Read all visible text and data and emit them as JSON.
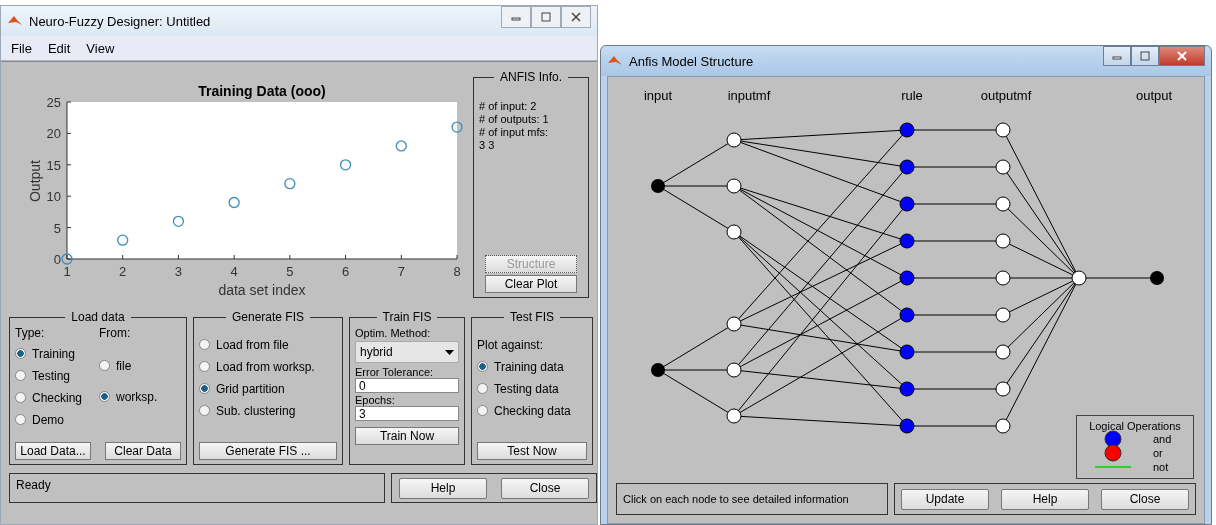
{
  "left_window": {
    "title": "Neuro-Fuzzy Designer: Untitled",
    "menu": [
      "File",
      "Edit",
      "View"
    ],
    "plot": {
      "chart_data": {
        "type": "scatter",
        "title": "Training Data (ooo)",
        "xlabel": "data set index",
        "ylabel": "Output",
        "x": [
          1,
          2,
          3,
          4,
          5,
          6,
          7,
          8
        ],
        "series": [
          {
            "color": "#3a8fb7",
            "values": [
              0,
              3,
              6,
              9,
              12,
              15,
              18,
              21
            ]
          }
        ],
        "xlim": [
          1,
          8
        ],
        "ylim": [
          0,
          25
        ],
        "xticks": [
          1,
          2,
          3,
          4,
          5,
          6,
          7,
          8
        ],
        "yticks": [
          0,
          5,
          10,
          15,
          20,
          25
        ]
      }
    },
    "anfis_info": {
      "title": "ANFIS Info.",
      "lines": [
        "# of input: 2",
        "# of outputs: 1",
        "# of input mfs:",
        "3  3"
      ],
      "buttons": [
        {
          "label": "Structure",
          "disabled": true
        },
        {
          "label": "Clear Plot",
          "disabled": false
        }
      ]
    },
    "load_data": {
      "title": "Load data",
      "type_label": "Type:",
      "from_label": "From:",
      "types": [
        {
          "label": "Training",
          "selected": true
        },
        {
          "label": "Testing",
          "selected": false
        },
        {
          "label": "Checking",
          "selected": false
        },
        {
          "label": "Demo",
          "selected": false
        }
      ],
      "sources": [
        {
          "label": "file",
          "selected": false
        },
        {
          "label": "worksp.",
          "selected": true
        }
      ],
      "buttons": [
        "Load Data...",
        "Clear Data"
      ]
    },
    "generate_fis": {
      "title": "Generate FIS",
      "options": [
        {
          "label": "Load from file",
          "selected": false
        },
        {
          "label": "Load from worksp.",
          "selected": false
        },
        {
          "label": "Grid partition",
          "selected": true
        },
        {
          "label": "Sub. clustering",
          "selected": false
        }
      ],
      "button": "Generate FIS ..."
    },
    "train_fis": {
      "title": "Train FIS",
      "method_label": "Optim. Method:",
      "method": "hybrid",
      "tolerance_label": "Error Tolerance:",
      "tolerance": "0",
      "epochs_label": "Epochs:",
      "epochs": "3",
      "button": "Train Now"
    },
    "test_fis": {
      "title": "Test FIS",
      "plot_label": "Plot against:",
      "options": [
        {
          "label": "Training data",
          "selected": true
        },
        {
          "label": "Testing data",
          "selected": false
        },
        {
          "label": "Checking data",
          "selected": false
        }
      ],
      "button": "Test Now"
    },
    "status": "Ready",
    "buttons": [
      "Help",
      "Close"
    ]
  },
  "right_window": {
    "title": "Anfis Model Structure",
    "layers": [
      "input",
      "inputmf",
      "rule",
      "outputmf",
      "output"
    ],
    "rules": [
      {
        "kind": "and"
      },
      {
        "kind": "and"
      },
      {
        "kind": "and"
      },
      {
        "kind": "and"
      },
      {
        "kind": "and"
      },
      {
        "kind": "and"
      },
      {
        "kind": "and"
      },
      {
        "kind": "and"
      },
      {
        "kind": "and"
      }
    ],
    "legend": {
      "title": "Logical Operations",
      "items": [
        {
          "kind": "and",
          "label": "and"
        },
        {
          "kind": "or",
          "label": "or"
        },
        {
          "kind": "not",
          "label": "not"
        }
      ]
    },
    "hint": "Click on each node to see detailed information",
    "buttons": [
      "Update",
      "Help",
      "Close"
    ]
  }
}
